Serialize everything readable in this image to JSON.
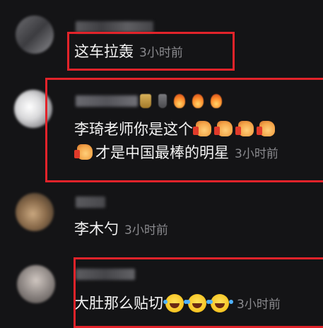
{
  "comments": [
    {
      "text": "这车拉轰",
      "time": "3小时前"
    },
    {
      "line1": "李琦老师你是这个",
      "line2": "才是中国最棒的明星",
      "time": "3小时前"
    },
    {
      "text": "李木勺",
      "time": "3小时前"
    },
    {
      "text": "大肚那么贴切",
      "time": "3小时前"
    }
  ],
  "colors": {
    "background": "#141416",
    "highlight": "#e2232a",
    "timestamp": "#8a8a8e",
    "text": "#f4f4f4"
  },
  "icons": [
    "thumbs-up-icon",
    "laughing-tears-icon",
    "fire-badge-icon",
    "level-badge-icon"
  ]
}
